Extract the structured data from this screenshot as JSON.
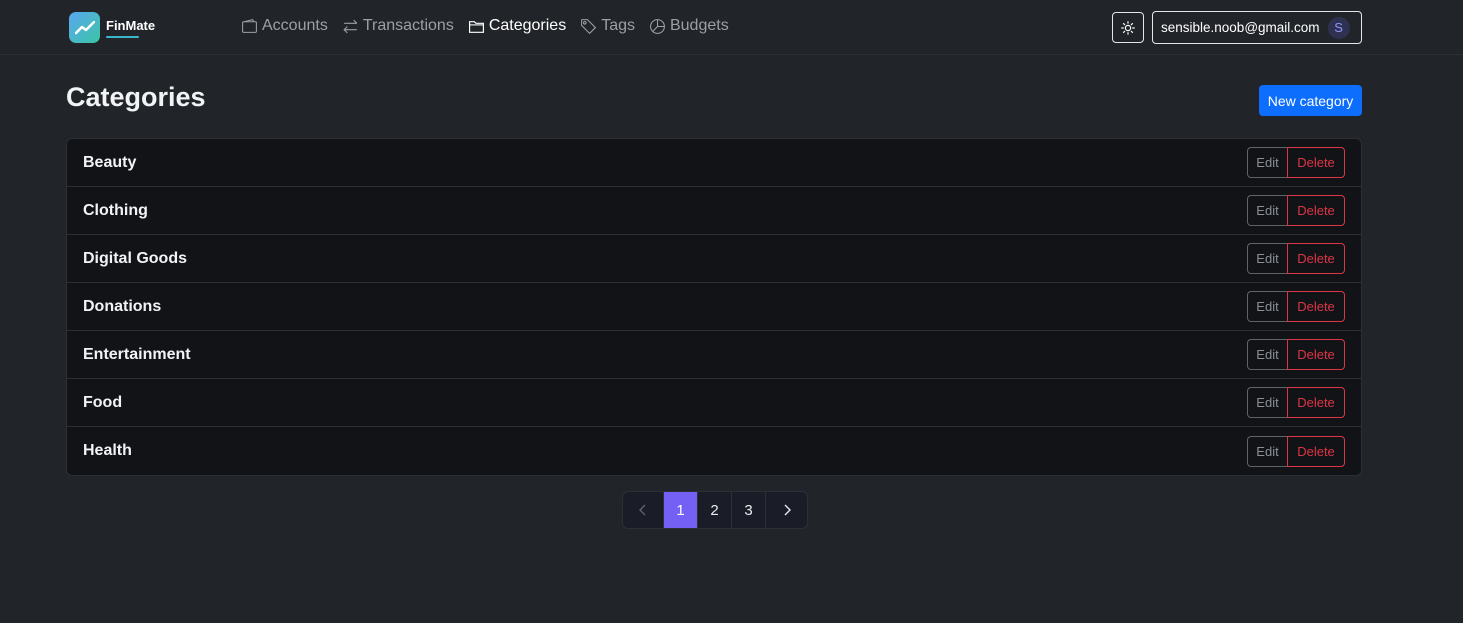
{
  "brand": {
    "name": "FinMate"
  },
  "nav": [
    {
      "label": "Accounts",
      "icon": "wallet-icon",
      "active": false
    },
    {
      "label": "Transactions",
      "icon": "arrows-exchange-icon",
      "active": false
    },
    {
      "label": "Categories",
      "icon": "folder-icon",
      "active": true
    },
    {
      "label": "Tags",
      "icon": "tag-icon",
      "active": false
    },
    {
      "label": "Budgets",
      "icon": "pie-chart-icon",
      "active": false
    }
  ],
  "header": {
    "theme_icon": "sun-icon",
    "user_email": "sensible.noob@gmail.com",
    "avatar_initial": "S"
  },
  "page": {
    "title": "Categories",
    "new_button": "New category"
  },
  "categories": [
    {
      "name": "Beauty",
      "edit": "Edit",
      "delete": "Delete"
    },
    {
      "name": "Clothing",
      "edit": "Edit",
      "delete": "Delete"
    },
    {
      "name": "Digital Goods",
      "edit": "Edit",
      "delete": "Delete"
    },
    {
      "name": "Donations",
      "edit": "Edit",
      "delete": "Delete"
    },
    {
      "name": "Entertainment",
      "edit": "Edit",
      "delete": "Delete"
    },
    {
      "name": "Food",
      "edit": "Edit",
      "delete": "Delete"
    },
    {
      "name": "Health",
      "edit": "Edit",
      "delete": "Delete"
    }
  ],
  "pagination": {
    "pages": [
      "1",
      "2",
      "3"
    ],
    "current": "1"
  },
  "colors": {
    "background": "#212529",
    "primary": "#0d6efd",
    "danger": "#dc3545",
    "active_page": "#7460f5"
  }
}
